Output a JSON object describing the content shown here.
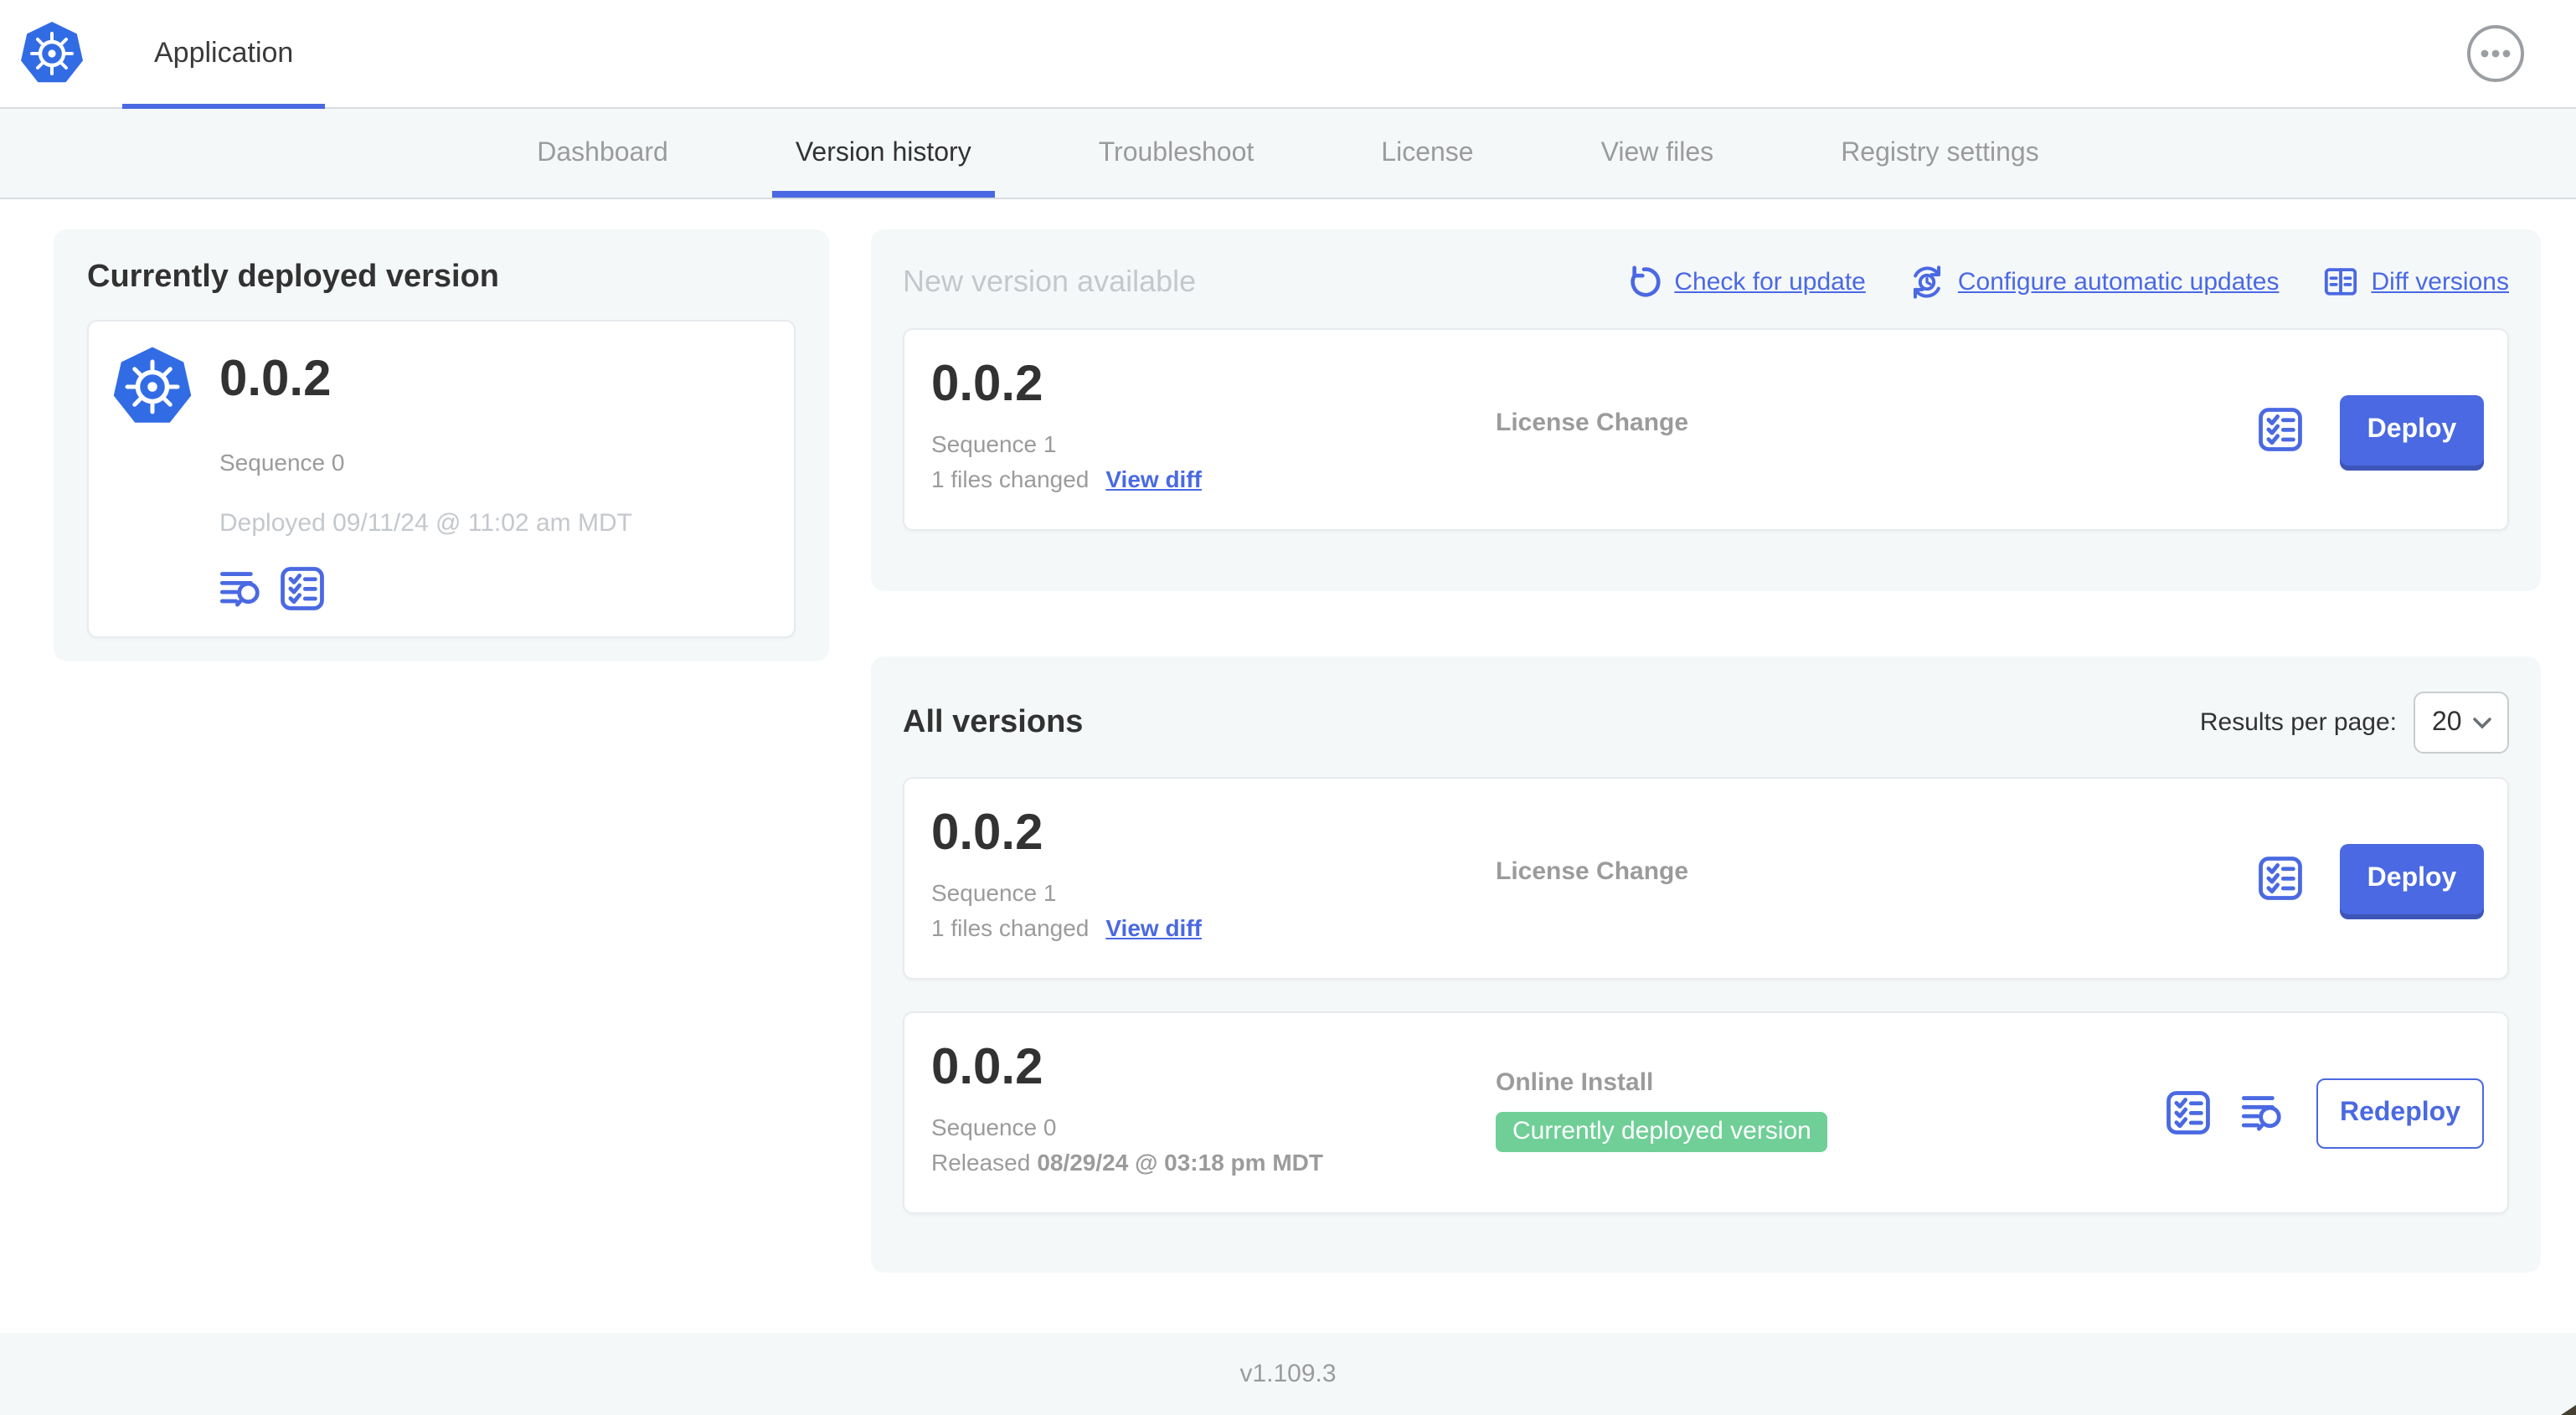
{
  "header": {
    "app_tab": "Application"
  },
  "nav": {
    "tabs": [
      "Dashboard",
      "Version history",
      "Troubleshoot",
      "License",
      "View files",
      "Registry settings"
    ],
    "active_tab": "Version history"
  },
  "current": {
    "title": "Currently deployed version",
    "version": "0.0.2",
    "sequence": "Sequence 0",
    "deployed": "Deployed 09/11/24 @ 11:02 am MDT"
  },
  "new_version": {
    "title": "New version available",
    "actions": [
      {
        "label": "Check for update",
        "icon": "refresh-icon"
      },
      {
        "label": "Configure automatic updates",
        "icon": "schedule-icon"
      },
      {
        "label": "Diff versions",
        "icon": "diff-icon"
      }
    ],
    "card": {
      "version": "0.0.2",
      "sequence": "Sequence 1",
      "files_changed": "1 files changed",
      "view_diff": "View diff",
      "source": "License Change",
      "deploy_label": "Deploy"
    }
  },
  "all_versions": {
    "title": "All versions",
    "results_per_page_label": "Results per page:",
    "results_per_page_value": "20",
    "rows": [
      {
        "version": "0.0.2",
        "sequence": "Sequence 1",
        "files_changed": "1 files changed",
        "view_diff": "View diff",
        "source": "License Change",
        "action_label": "Deploy"
      },
      {
        "version": "0.0.2",
        "sequence": "Sequence 0",
        "released_prefix": "Released",
        "released_date": "08/29/24 @ 03:18 pm MDT",
        "source": "Online Install",
        "badge": "Currently deployed version",
        "action_label": "Redeploy"
      }
    ]
  },
  "footer": {
    "version": "v1.109.3"
  },
  "colors": {
    "accent_blue": "#4A69E2",
    "kubernetes_blue": "#326CE5",
    "badge_green": "#6FCF97"
  }
}
